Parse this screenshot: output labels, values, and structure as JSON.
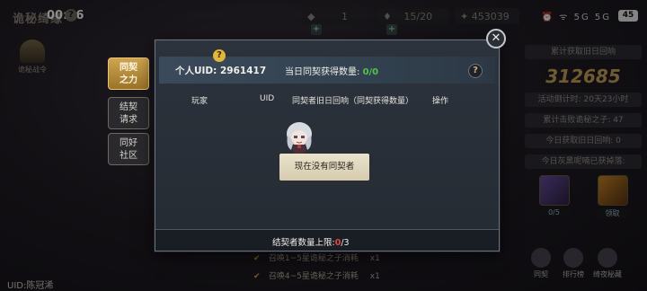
{
  "status_bar": {
    "game_title": "诡秘绮缘",
    "clock": "00:16",
    "help_glyph": "?",
    "gem_count": "1",
    "stamina": "15/20",
    "coins": "453039",
    "battery": "45",
    "system_icons": "⏰ ᯤ 5G 5G"
  },
  "left_event": {
    "label": "诡秘战令"
  },
  "bottom_uid": "UID:陈冠浠",
  "right_panel": {
    "row1": "累计获取旧日回响",
    "big_value": "312685",
    "countdown": "活动倒计时: 20天23小时",
    "defeats": "累计击败诡秘之子: 47",
    "today_echo": "今日获取旧日回响: 0",
    "gray_drop": "今日灰黑呢喃已获掉落:",
    "item1_count": "0/5",
    "item2_label": "领取",
    "nav": [
      "同契",
      "排行榜",
      "绮夜秘藏"
    ]
  },
  "summons": [
    {
      "text": "召唤1~5星诡秘之子消耗",
      "qty": "x1"
    },
    {
      "text": "召唤4~5星诡秘之子消耗",
      "qty": "x1"
    }
  ],
  "modal": {
    "uid_text": "个人UID: 2961417",
    "today_label": "当日同契获得数量:",
    "today_value": "0/0",
    "help_glyph": "?",
    "columns": [
      "玩家",
      "UID",
      "同契者旧日回响（同契获得数量）",
      "操作"
    ],
    "empty_text": "现在没有同契者",
    "limit_label": "结契者数量上限:",
    "limit_current": "0",
    "limit_max": "/3",
    "close_glyph": "✕"
  },
  "tabs": [
    {
      "label_top": "同契",
      "label_bottom": "之力",
      "active": true
    },
    {
      "label_top": "结契",
      "label_bottom": "请求",
      "active": false
    },
    {
      "label_top": "同好",
      "label_bottom": "社区",
      "active": false
    }
  ],
  "colors": {
    "accent_gold": "#cfa54f",
    "positive_green": "#57c24a",
    "limit_red": "#e04a3a",
    "modal_bg": "#2c333c"
  },
  "icons": {
    "close": "close-icon",
    "help": "question-icon",
    "checkmark": "check-icon",
    "mascot": "chibi-character-icon"
  }
}
